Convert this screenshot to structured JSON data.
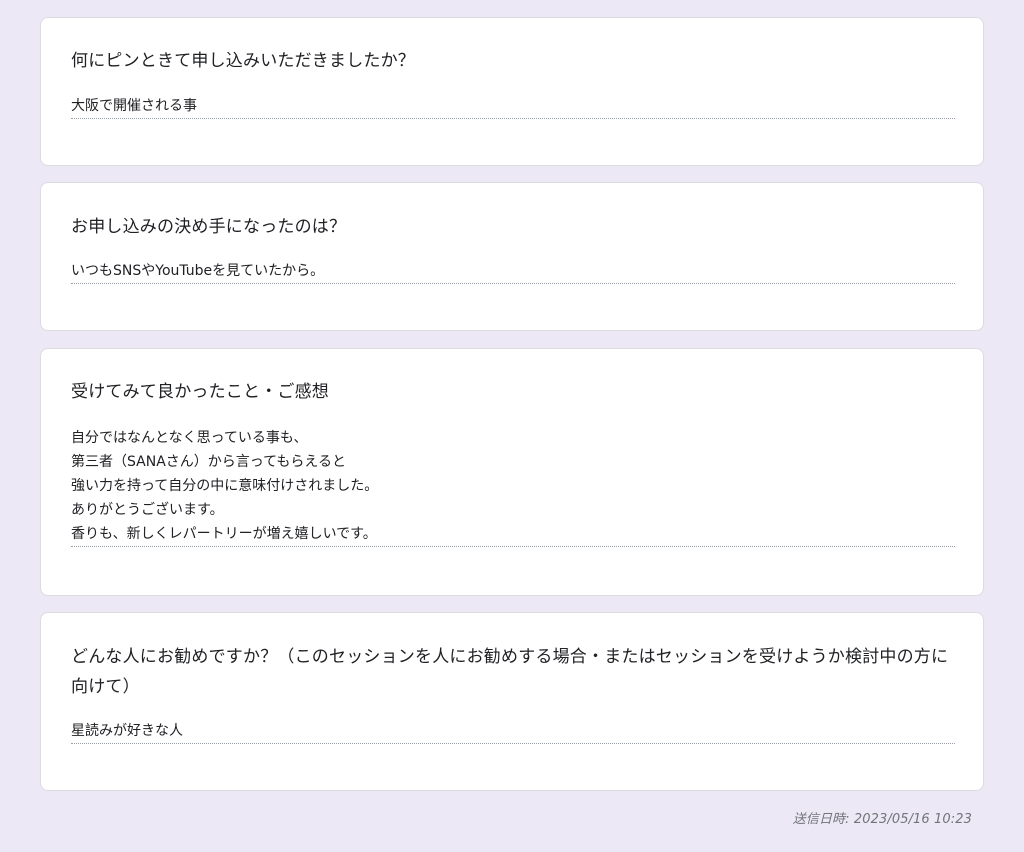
{
  "responses": [
    {
      "question": "何にピンときて申し込みいただきましたか？",
      "answer": "大阪で開催される事"
    },
    {
      "question": "お申し込みの決め手になったのは？",
      "answer": "いつもSNSやYouTubeを見ていたから。"
    },
    {
      "question": "受けてみて良かったこと・ご感想",
      "answer": "自分ではなんとなく思っている事も、\n第三者（SANAさん）から言ってもらえると\n強い力を持って自分の中に意味付けされました。\nありがとうございます。\n香りも、新しくレパートリーが増え嬉しいです。"
    },
    {
      "question": "どんな人にお勧めですか？（このセッションを人にお勧めする場合・またはセッションを受けようか検討中の方に向けて）",
      "answer": "星読みが好きな人"
    }
  ],
  "footer": {
    "submitted_timestamp": "送信日時: 2023/05/16 10:23"
  }
}
